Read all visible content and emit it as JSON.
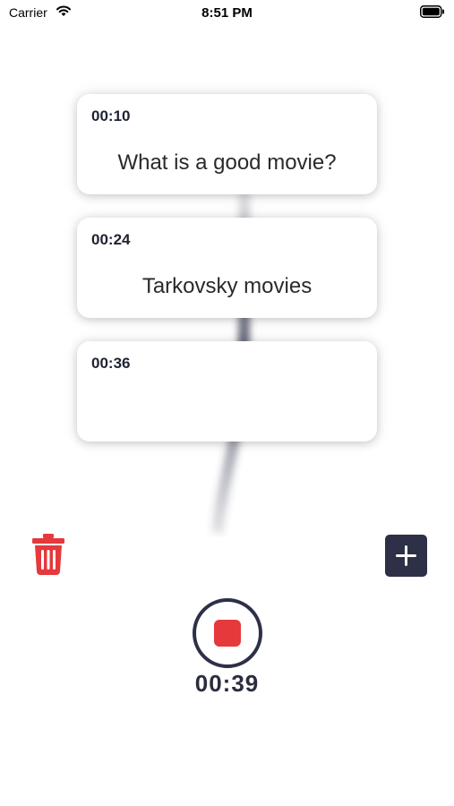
{
  "status_bar": {
    "carrier": "Carrier",
    "time": "8:51 PM",
    "icons": [
      "wifi-icon",
      "battery-icon"
    ]
  },
  "cards": [
    {
      "time": "00:10",
      "text": "What is a good movie?"
    },
    {
      "time": "00:24",
      "text": "Tarkovsky movies"
    },
    {
      "time": "00:36",
      "text": ""
    }
  ],
  "actions": {
    "delete_icon": "trash-icon",
    "add_icon": "plus-icon"
  },
  "recorder": {
    "state": "recording",
    "icon": "stop-icon",
    "elapsed": "00:39"
  },
  "colors": {
    "accent_red": "#e5393c",
    "navy": "#2d3047",
    "text_dark": "#1f2233"
  }
}
